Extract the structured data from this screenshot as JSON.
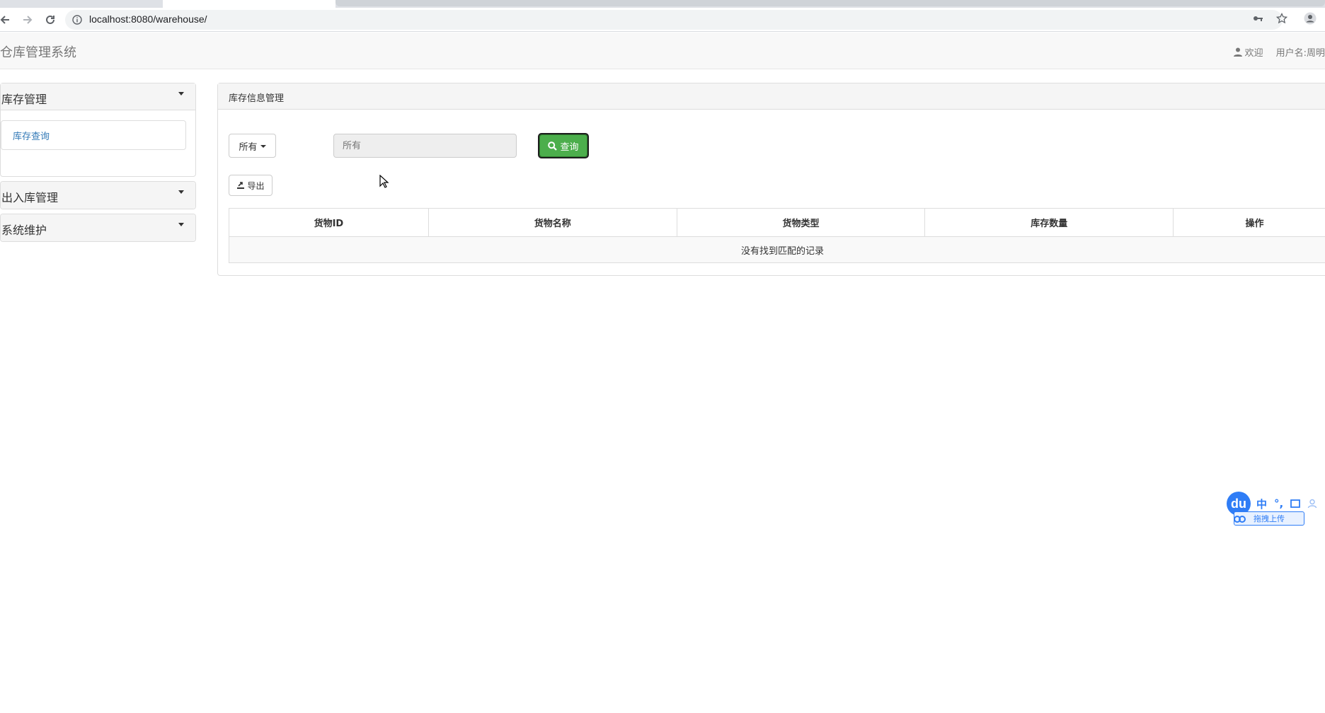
{
  "browser": {
    "url": "localhost:8080/warehouse/"
  },
  "header": {
    "brand": "仓库管理系统",
    "welcome": "欢迎",
    "username": "用户名:周明"
  },
  "sidebar": {
    "groups": [
      {
        "label": "库存管理",
        "expanded": true,
        "items": [
          {
            "label": "库存查询"
          }
        ]
      },
      {
        "label": "出入库管理",
        "expanded": false
      },
      {
        "label": "系统维护",
        "expanded": false
      }
    ]
  },
  "main": {
    "title": "库存信息管理",
    "filter_dropdown": "所有",
    "search_placeholder": "所有",
    "query_button": "查询",
    "export_button": "导出",
    "table": {
      "columns": [
        "货物ID",
        "货物名称",
        "货物类型",
        "库存数量",
        "操作"
      ],
      "empty_message": "没有找到匹配的记录"
    }
  },
  "ime": {
    "logo": "du",
    "mode": "中",
    "punct": "°,",
    "upload_label": "拖拽上传"
  },
  "colors": {
    "query_button_bg": "#4cae4c",
    "link_blue": "#337ab7",
    "ime_blue": "#2f7df6"
  }
}
